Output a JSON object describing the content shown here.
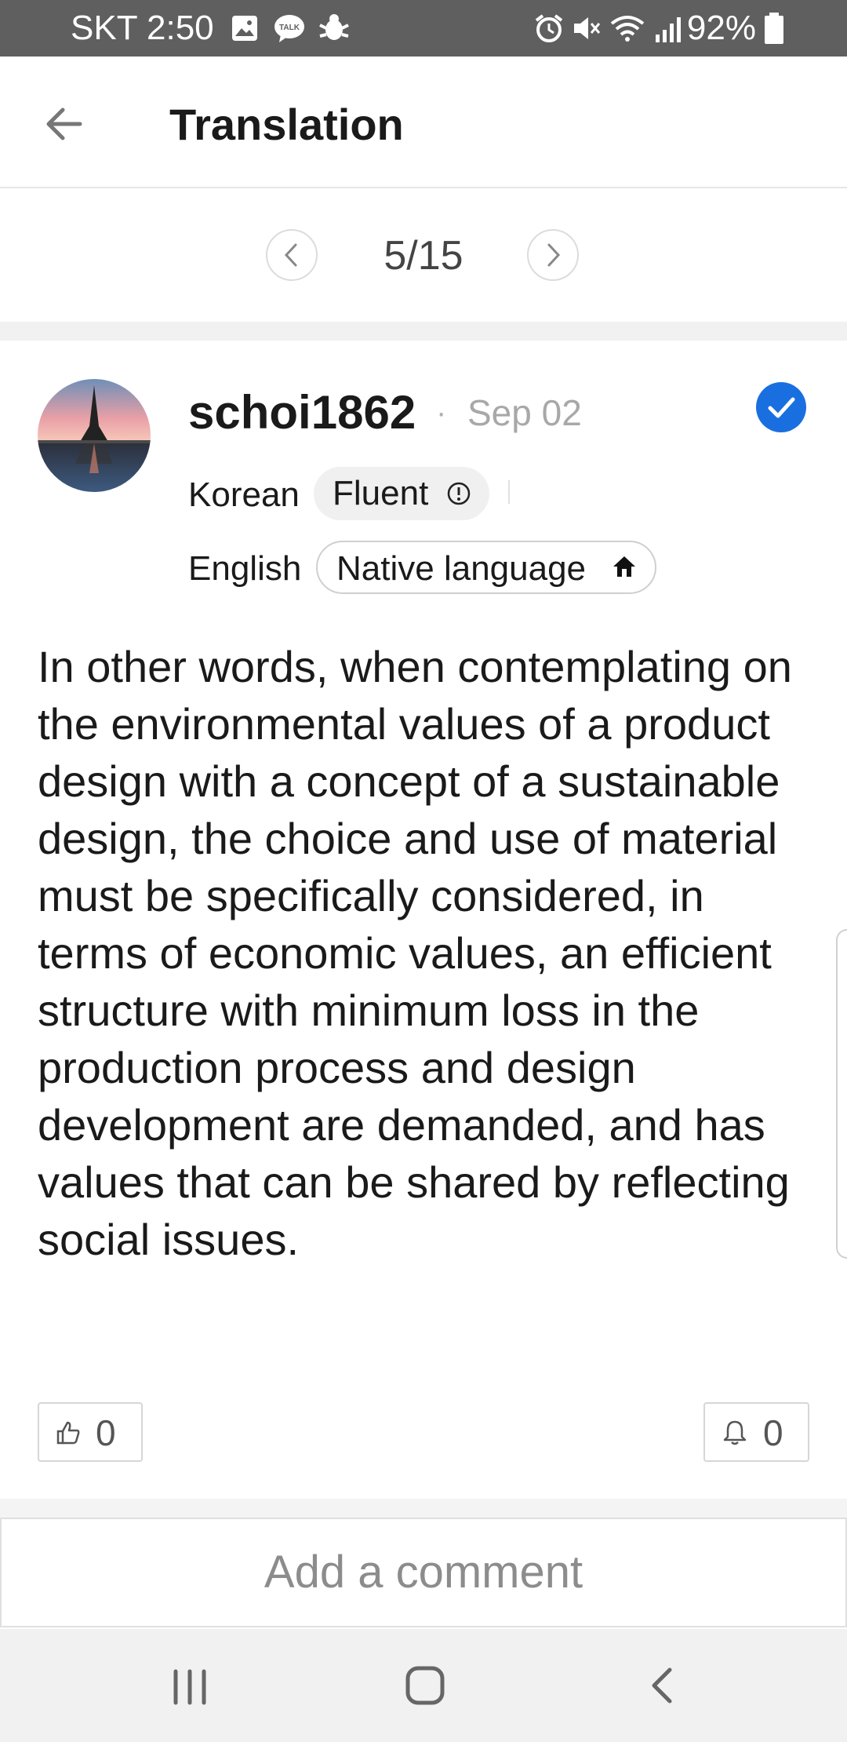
{
  "status_bar": {
    "carrier_time": "SKT 2:50",
    "battery": "92%",
    "left_icons": [
      "image-icon",
      "talk-icon",
      "bug-icon"
    ],
    "right_icons": [
      "alarm-icon",
      "mute-icon",
      "wifi-icon",
      "signal-icon",
      "battery-icon"
    ]
  },
  "header": {
    "title": "Translation",
    "back_icon": "arrow-left-icon"
  },
  "pager": {
    "counter": "5/15",
    "prev_icon": "chevron-left-icon",
    "next_icon": "chevron-right-icon"
  },
  "post": {
    "username": "schoi1862",
    "separator": "·",
    "date": "Sep 02",
    "verified_icon": "checkmark-icon",
    "languages": [
      {
        "language": "Korean",
        "level": "Fluent",
        "level_icon": "info-icon"
      },
      {
        "language": "English",
        "level": "Native language",
        "level_icon": "home-icon"
      }
    ],
    "body": "In other words, when contemplating on the environmental values of a product design with a concept of a sustainable design, the choice and use of material must be specifically considered, in terms of economic values, an efficient structure with minimum loss in the production process and design development are demanded, and has values that can be shared by reflecting social issues.",
    "likes": "0",
    "notifications": "0"
  },
  "comment": {
    "placeholder": "Add a comment"
  },
  "nav_bar": {
    "icons": [
      "recent-apps-icon",
      "home-button-icon",
      "back-icon"
    ]
  },
  "colors": {
    "status_bar": "#5f5f5f",
    "accent_blue": "#1a6fe0",
    "text_primary": "#1a1a1a",
    "text_muted": "#a8a8a8"
  }
}
